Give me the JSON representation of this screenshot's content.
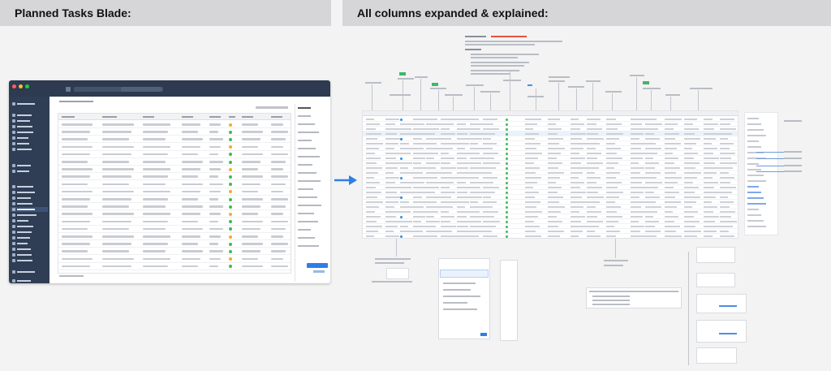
{
  "headers": {
    "left": "Planned Tasks Blade:",
    "right": "All columns expanded & explained:"
  },
  "colors": {
    "header_bg": "#d6d6d8",
    "sidebar_bg": "#2f3e55",
    "titlebar_bg": "#2d3a4f",
    "accent_blue": "#2f7ee6",
    "status_green": "#3fb95c",
    "tag_green": "#41b66a",
    "annotation_red": "#e5533d"
  },
  "icons": {
    "arrow": "arrow-right-icon"
  }
}
